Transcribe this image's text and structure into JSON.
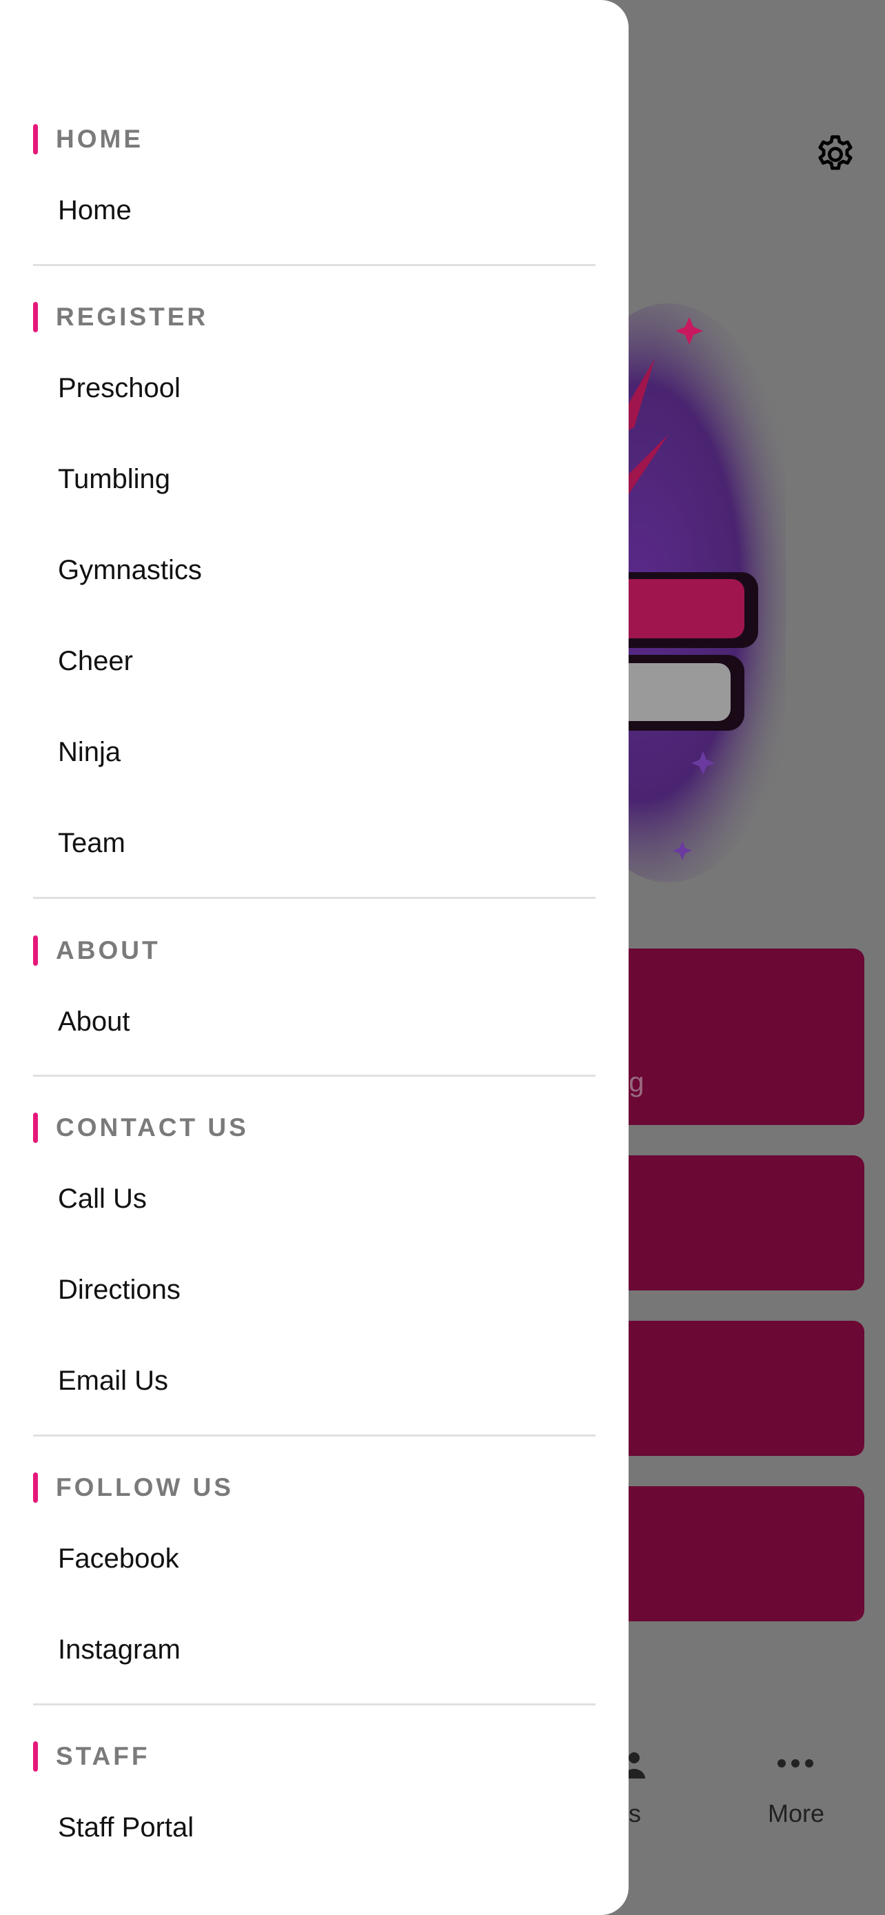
{
  "drawer": {
    "sections": [
      {
        "title": "HOME",
        "items": [
          "Home"
        ]
      },
      {
        "title": "REGISTER",
        "items": [
          "Preschool",
          "Tumbling",
          "Gymnastics",
          "Cheer",
          "Ninja",
          "Team"
        ]
      },
      {
        "title": "ABOUT",
        "items": [
          "About"
        ]
      },
      {
        "title": "CONTACT US",
        "items": [
          "Call Us",
          "Directions",
          "Email Us"
        ]
      },
      {
        "title": "FOLLOW US",
        "items": [
          "Facebook",
          "Instagram"
        ]
      },
      {
        "title": "STAFF",
        "items": [
          "Staff Portal"
        ]
      }
    ]
  },
  "background": {
    "card1_partial_text": "ng",
    "tabs": {
      "groups_partial": "ups",
      "more": "More"
    },
    "colors": {
      "card": "#6b0834",
      "accent": "#e6177a",
      "overlay": "#777777"
    },
    "icons": {
      "settings": "gear-icon",
      "groups": "groups-icon",
      "more": "more-dots-icon"
    }
  }
}
